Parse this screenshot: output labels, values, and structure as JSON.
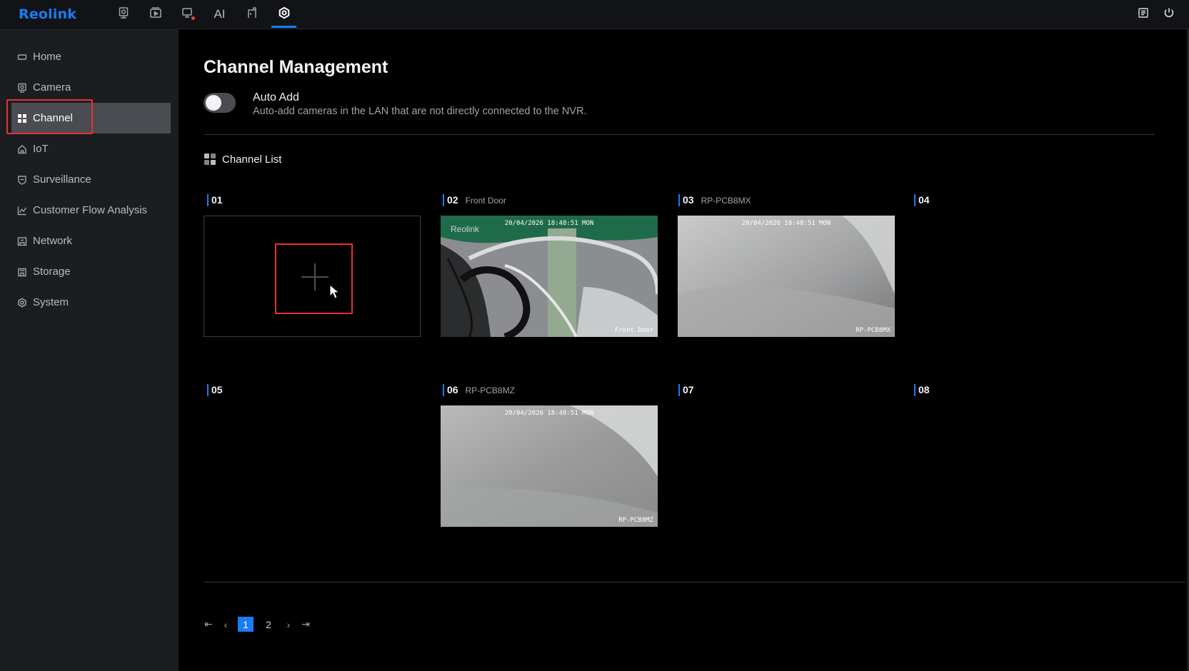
{
  "app": {
    "logo": "Reolink"
  },
  "topnav": {
    "items": [
      {
        "icon": "live-view-icon",
        "active": false
      },
      {
        "icon": "playback-icon",
        "active": false
      },
      {
        "icon": "recording-alert-icon",
        "active": false
      },
      {
        "icon": "ai-icon",
        "label": "AI",
        "active": false
      },
      {
        "icon": "file-icon",
        "active": false
      },
      {
        "icon": "settings-icon",
        "active": true
      }
    ],
    "right": [
      {
        "icon": "notes-icon"
      },
      {
        "icon": "power-icon"
      }
    ]
  },
  "sidebar": {
    "items": [
      {
        "label": "Home",
        "icon": "home-icon"
      },
      {
        "label": "Camera",
        "icon": "camera-icon"
      },
      {
        "label": "Channel",
        "icon": "grid-icon",
        "active": true
      },
      {
        "label": "IoT",
        "icon": "iot-home-icon"
      },
      {
        "label": "Surveillance",
        "icon": "shield-icon"
      },
      {
        "label": "Customer Flow Analysis",
        "icon": "chart-line-icon"
      },
      {
        "label": "Network",
        "icon": "network-icon"
      },
      {
        "label": "Storage",
        "icon": "storage-icon"
      },
      {
        "label": "System",
        "icon": "system-gear-icon"
      }
    ]
  },
  "main": {
    "title": "Channel Management",
    "auto_add": {
      "label": "Auto Add",
      "description": "Auto-add cameras in the LAN that are not directly connected to the NVR.",
      "enabled": false
    },
    "channel_list": {
      "heading": "Channel List",
      "channels": [
        {
          "num": "01",
          "name": "",
          "state": "empty-add"
        },
        {
          "num": "02",
          "name": "Front Door",
          "state": "feed",
          "osd_time": "20/04/2026 18:48:51 MON",
          "osd_name": "Front Door",
          "osd_logo": "Reolink"
        },
        {
          "num": "03",
          "name": "RP-PCB8MX",
          "state": "feed",
          "osd_time": "20/04/2026 18:48:51 MON",
          "osd_name": "RP-PCB8MX"
        },
        {
          "num": "04",
          "name": "",
          "state": "none"
        },
        {
          "num": "05",
          "name": "",
          "state": "none"
        },
        {
          "num": "06",
          "name": "RP-PCB8MZ",
          "state": "feed",
          "osd_time": "20/04/2026 18:48:51 MON",
          "osd_name": "RP-PCB8MZ"
        },
        {
          "num": "07",
          "name": "",
          "state": "none"
        },
        {
          "num": "08",
          "name": "",
          "state": "none"
        }
      ]
    },
    "pagination": {
      "first": "⇤",
      "prev": "‹",
      "next": "›",
      "last": "⇥",
      "pages": [
        "1",
        "2"
      ],
      "current": "1"
    }
  },
  "colors": {
    "accent": "#1a7cf5",
    "highlight": "#e5322f",
    "sidebar_bg": "#1c1d20",
    "active_bg": "#4a4c51"
  }
}
